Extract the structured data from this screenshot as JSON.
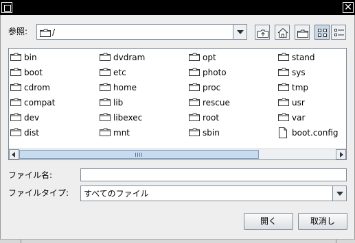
{
  "dialog": {
    "lookin_label": "参照:",
    "lookin_value": "/",
    "filename_label": "ファイル名:",
    "filename_value": "",
    "filetype_label": "ファイルタイプ:",
    "filetype_value": "すべてのファイル",
    "open_label": "開く",
    "cancel_label": "取消し"
  },
  "toolbar": {
    "up_icon": "up-folder-icon",
    "home_icon": "home-icon",
    "new_folder_icon": "new-folder-icon",
    "list_view_icon": "list-view-icon",
    "details_view_icon": "details-view-icon"
  },
  "files": [
    {
      "name": "bin",
      "type": "folder"
    },
    {
      "name": "boot",
      "type": "folder"
    },
    {
      "name": "cdrom",
      "type": "folder"
    },
    {
      "name": "compat",
      "type": "folder"
    },
    {
      "name": "dev",
      "type": "folder"
    },
    {
      "name": "dist",
      "type": "folder"
    },
    {
      "name": "dvdram",
      "type": "folder"
    },
    {
      "name": "etc",
      "type": "folder"
    },
    {
      "name": "home",
      "type": "folder"
    },
    {
      "name": "lib",
      "type": "folder"
    },
    {
      "name": "libexec",
      "type": "folder"
    },
    {
      "name": "mnt",
      "type": "folder"
    },
    {
      "name": "opt",
      "type": "folder"
    },
    {
      "name": "photo",
      "type": "folder"
    },
    {
      "name": "proc",
      "type": "folder"
    },
    {
      "name": "rescue",
      "type": "folder"
    },
    {
      "name": "root",
      "type": "folder"
    },
    {
      "name": "sbin",
      "type": "folder"
    },
    {
      "name": "stand",
      "type": "folder"
    },
    {
      "name": "sys",
      "type": "folder"
    },
    {
      "name": "tmp",
      "type": "folder"
    },
    {
      "name": "usr",
      "type": "folder"
    },
    {
      "name": "var",
      "type": "folder"
    },
    {
      "name": "boot.config",
      "type": "file"
    }
  ]
}
